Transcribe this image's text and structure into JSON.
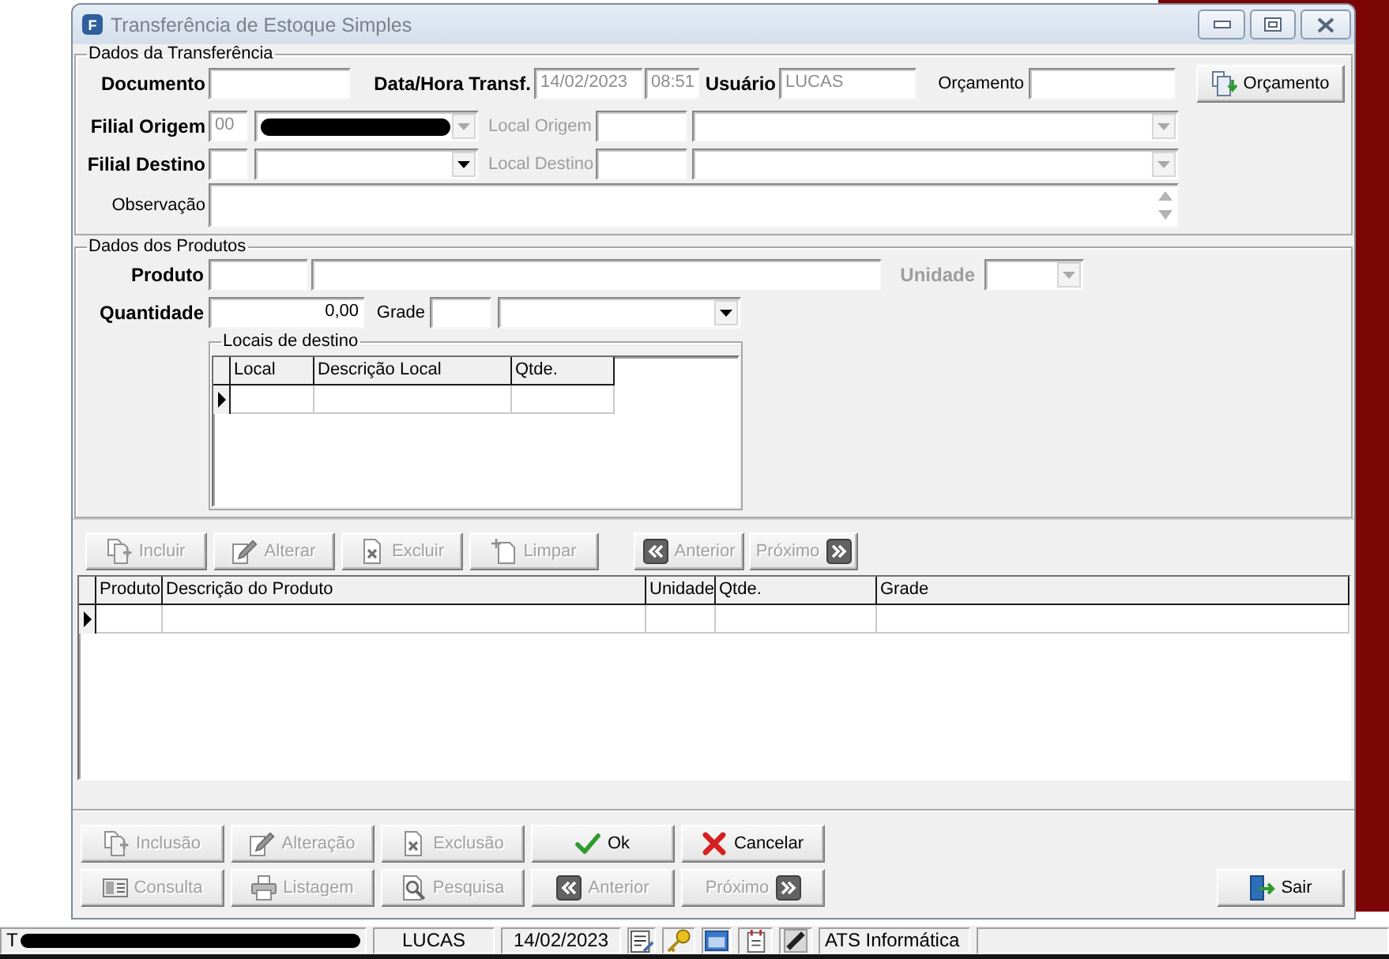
{
  "window": {
    "app_icon_letter": "F",
    "title": "Transferência de Estoque Simples",
    "active": false
  },
  "transfer": {
    "title": "Dados da Transferência",
    "documento": {
      "label": "Documento"
    },
    "data_hora": {
      "label": "Data/Hora Transf.",
      "date": "14/02/2023",
      "time": "08:51",
      "disabled": true
    },
    "usuario": {
      "label": "Usuário",
      "value": "LUCAS",
      "disabled": true
    },
    "orcamento": {
      "label": "Orçamento"
    },
    "orcamento_button": {
      "label": "Orçamento",
      "disabled": false
    },
    "filial_origem": {
      "label": "Filial Origem",
      "code": "00",
      "name_redacted": true,
      "disabled": true
    },
    "local_origem": {
      "label": "Local Origem",
      "disabled": true
    },
    "filial_destino": {
      "label": "Filial Destino",
      "disabled": false
    },
    "local_destino": {
      "label": "Local Destino",
      "disabled": true
    },
    "observacao": {
      "label": "Observação"
    }
  },
  "products": {
    "title": "Dados dos Produtos",
    "produto": {
      "label": "Produto"
    },
    "unidade": {
      "label": "Unidade",
      "disabled": true
    },
    "quantidade": {
      "label": "Quantidade",
      "value": "0,00"
    },
    "grade": {
      "label": "Grade",
      "disabled": false
    },
    "locais": {
      "title": "Locais de destino",
      "columns": [
        "Local",
        "Descrição Local",
        "Qtde."
      ],
      "rows": [
        {
          "current": true
        }
      ]
    }
  },
  "toolbar": [
    {
      "label": "Incluir",
      "disabled": true
    },
    {
      "label": "Alterar",
      "disabled": true
    },
    {
      "label": "Excluir",
      "disabled": true
    },
    {
      "label": "Limpar",
      "disabled": true
    },
    {
      "label": "Anterior",
      "disabled": true
    },
    {
      "label": "Próximo",
      "disabled": true
    }
  ],
  "products_grid": {
    "columns": [
      "Produto",
      "Descrição do Produto",
      "Unidade",
      "Qtde.",
      "Grade"
    ],
    "rows": [
      {
        "current": true
      }
    ]
  },
  "action_rows": [
    {
      "buttons": [
        {
          "label": "Inclusão",
          "disabled": true
        },
        {
          "label": "Alteração",
          "disabled": true
        },
        {
          "label": "Exclusão",
          "disabled": true
        },
        {
          "label": "Ok",
          "disabled": false
        },
        {
          "label": "Cancelar",
          "disabled": false
        }
      ]
    },
    {
      "buttons": [
        {
          "label": "Consulta",
          "disabled": true
        },
        {
          "label": "Listagem",
          "disabled": true
        },
        {
          "label": "Pesquisa",
          "disabled": true
        },
        {
          "label": "Anterior",
          "disabled": true
        },
        {
          "label": "Próximo",
          "disabled": true
        }
      ]
    }
  ],
  "exit_button": {
    "label": "Sair",
    "disabled": false
  },
  "status_bar": {
    "panels": [
      {
        "kind": "redacted",
        "text": "T"
      },
      {
        "kind": "text",
        "text": "LUCAS"
      },
      {
        "kind": "text",
        "text": "14/02/2023"
      },
      {
        "kind": "icon"
      },
      {
        "kind": "icon"
      },
      {
        "kind": "icon"
      },
      {
        "kind": "icon"
      },
      {
        "kind": "icon"
      },
      {
        "kind": "text",
        "text": "ATS Informática"
      }
    ]
  }
}
